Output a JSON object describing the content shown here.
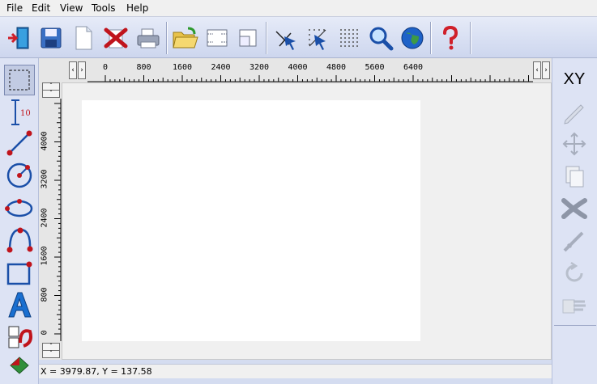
{
  "menubar": {
    "items": [
      "File",
      "Edit",
      "View",
      "Tools",
      "Help"
    ]
  },
  "ruler": {
    "horizontal_labels": [
      "0",
      "800",
      "1600",
      "2400",
      "3200",
      "4000",
      "4800",
      "5600",
      "6400"
    ],
    "vertical_labels": [
      "4000",
      "3200",
      "2400",
      "1600",
      "800",
      "0"
    ]
  },
  "right_toolbar": {
    "xy_label": "XY"
  },
  "status": {
    "coordinates": "X = 3979.87, Y = 137.58"
  },
  "colors": {
    "accent_red": "#c0141c",
    "accent_blue": "#1a4fa8",
    "chrome": "#d4dcf0"
  }
}
